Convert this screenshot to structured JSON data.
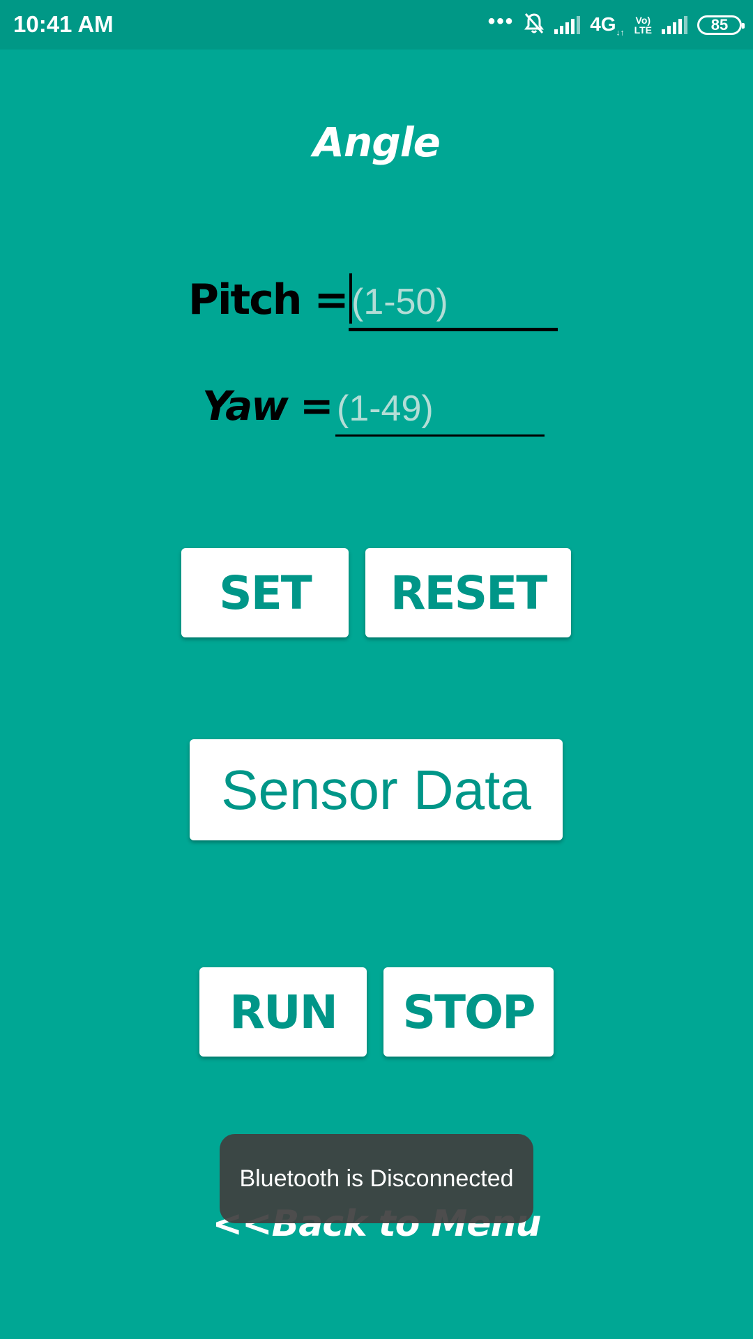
{
  "status_bar": {
    "time": "10:41 AM",
    "network": "4G",
    "volte_top": "Vo)",
    "volte_bottom": "LTE",
    "battery": "85"
  },
  "screen": {
    "title": "Angle",
    "pitch_label": "Pitch =",
    "pitch_placeholder": "(1-50)",
    "yaw_label": "Yaw =",
    "yaw_placeholder": "(1-49)"
  },
  "buttons": {
    "set": "SET",
    "reset": "RESET",
    "sensor_data": "Sensor Data",
    "run": "RUN",
    "stop": "STOP"
  },
  "back_link": "<<Back to Menu",
  "toast": "Bluetooth is Disconnected",
  "colors": {
    "background": "#00a794",
    "status_bar": "#009886",
    "button_text": "#009688",
    "toast": "#404040"
  }
}
